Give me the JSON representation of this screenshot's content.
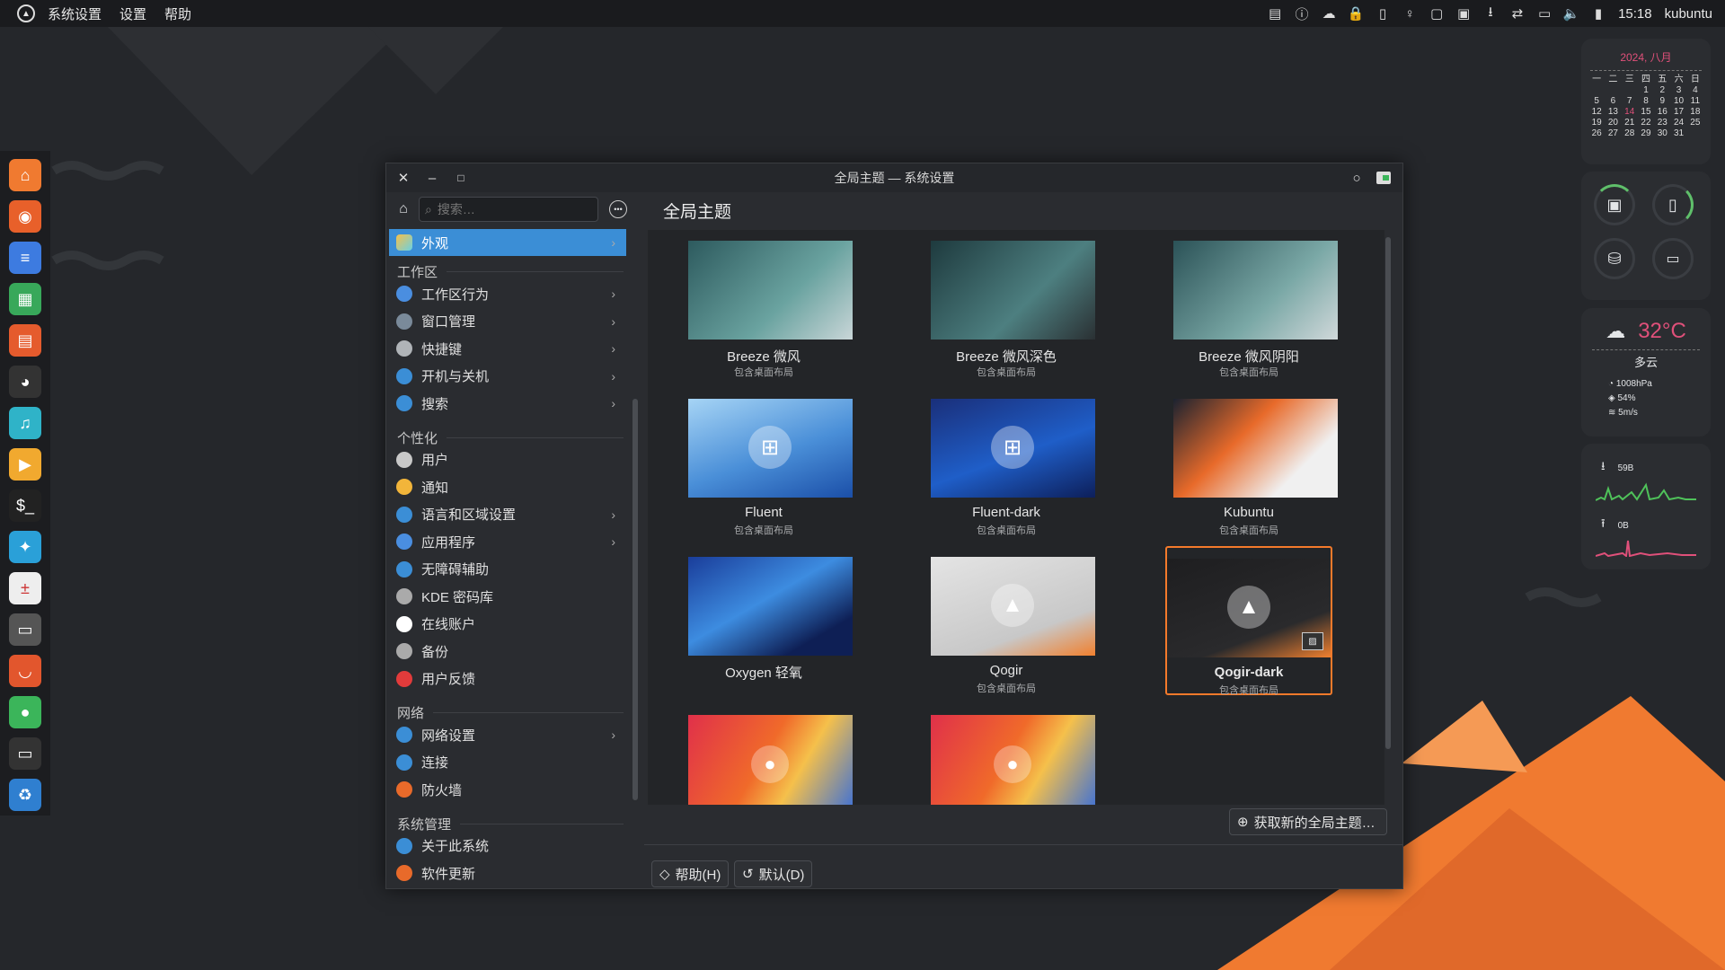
{
  "topbar": {
    "menu": [
      "系统设置",
      "设置",
      "帮助"
    ],
    "clock": "15:18",
    "user": "kubuntu",
    "tray_icons": [
      "clipboard-icon",
      "info-icon",
      "cloud-icon",
      "lock-icon",
      "battery-icon",
      "bulb-icon",
      "device-icon",
      "display-icon",
      "download-icon",
      "sync-icon",
      "monitor-icon",
      "volume-icon",
      "power-icon"
    ]
  },
  "dock": {
    "apps": [
      "home-folder-icon",
      "firefox-icon",
      "writer-icon",
      "calc-icon",
      "impress-icon",
      "cat-icon",
      "music-icon",
      "media-player-icon",
      "terminal-icon",
      "app-icon",
      "calculator-icon",
      "screen-recorder-icon",
      "store-icon",
      "toggle-icon",
      "display-icon",
      "trash-icon"
    ]
  },
  "calendar": {
    "title": "2024, 八月",
    "weekdays": [
      "一",
      "二",
      "三",
      "四",
      "五",
      "六",
      "日"
    ],
    "weeks": [
      [
        "",
        "",
        "",
        "1",
        "2",
        "3",
        "4"
      ],
      [
        "5",
        "6",
        "7",
        "8",
        "9",
        "10",
        "11"
      ],
      [
        "12",
        "13",
        "14",
        "15",
        "16",
        "17",
        "18"
      ],
      [
        "19",
        "20",
        "21",
        "22",
        "23",
        "24",
        "25"
      ],
      [
        "26",
        "27",
        "28",
        "29",
        "30",
        "31",
        ""
      ]
    ],
    "today": "14"
  },
  "weather": {
    "temp": "32°C",
    "condition": "多云",
    "pressure": "1008hPa",
    "humidity": "54%",
    "wind": "5m/s"
  },
  "network": {
    "download": "59B",
    "upload": "0B"
  },
  "window": {
    "title": "全局主题 — 系统设置",
    "search_placeholder": "搜索…",
    "page_title": "全局主题",
    "get_new": "获取新的全局主题…",
    "help_btn": "帮助(H)",
    "default_btn": "默认(D)"
  },
  "sidebar": {
    "active": "外观",
    "sections": [
      {
        "title": "工作区",
        "items": [
          {
            "label": "工作区行为",
            "chevron": true
          },
          {
            "label": "窗口管理",
            "chevron": true
          },
          {
            "label": "快捷键",
            "chevron": true
          },
          {
            "label": "开机与关机",
            "chevron": true
          },
          {
            "label": "搜索",
            "chevron": true
          }
        ]
      },
      {
        "title": "个性化",
        "items": [
          {
            "label": "用户",
            "chevron": false
          },
          {
            "label": "通知",
            "chevron": false
          },
          {
            "label": "语言和区域设置",
            "chevron": true
          },
          {
            "label": "应用程序",
            "chevron": true
          },
          {
            "label": "无障碍辅助",
            "chevron": false
          },
          {
            "label": "KDE 密码库",
            "chevron": false
          },
          {
            "label": "在线账户",
            "chevron": false
          },
          {
            "label": "备份",
            "chevron": false
          },
          {
            "label": "用户反馈",
            "chevron": false
          }
        ]
      },
      {
        "title": "网络",
        "items": [
          {
            "label": "网络设置",
            "chevron": true
          },
          {
            "label": "连接",
            "chevron": false
          },
          {
            "label": "防火墙",
            "chevron": false
          }
        ]
      },
      {
        "title": "系统管理",
        "items": [
          {
            "label": "关于此系统",
            "chevron": false
          },
          {
            "label": "软件更新",
            "chevron": false
          }
        ]
      }
    ]
  },
  "themes": [
    {
      "name": "Breeze 微风",
      "sub": "包含桌面布局"
    },
    {
      "name": "Breeze 微风深色",
      "sub": "包含桌面布局"
    },
    {
      "name": "Breeze 微风阴阳",
      "sub": "包含桌面布局"
    },
    {
      "name": "Fluent",
      "sub": "包含桌面布局"
    },
    {
      "name": "Fluent-dark",
      "sub": "包含桌面布局"
    },
    {
      "name": "Kubuntu",
      "sub": "包含桌面布局"
    },
    {
      "name": "Oxygen 轻氧",
      "sub": ""
    },
    {
      "name": "Qogir",
      "sub": "包含桌面布局"
    },
    {
      "name": "Qogir-dark",
      "sub": "包含桌面布局"
    },
    {
      "name": "",
      "sub": ""
    },
    {
      "name": "",
      "sub": ""
    }
  ],
  "selected_theme": "Qogir-dark",
  "colors": {
    "accent": "#3b8ed6",
    "selection": "#f47a2b",
    "today": "#e0507a"
  }
}
